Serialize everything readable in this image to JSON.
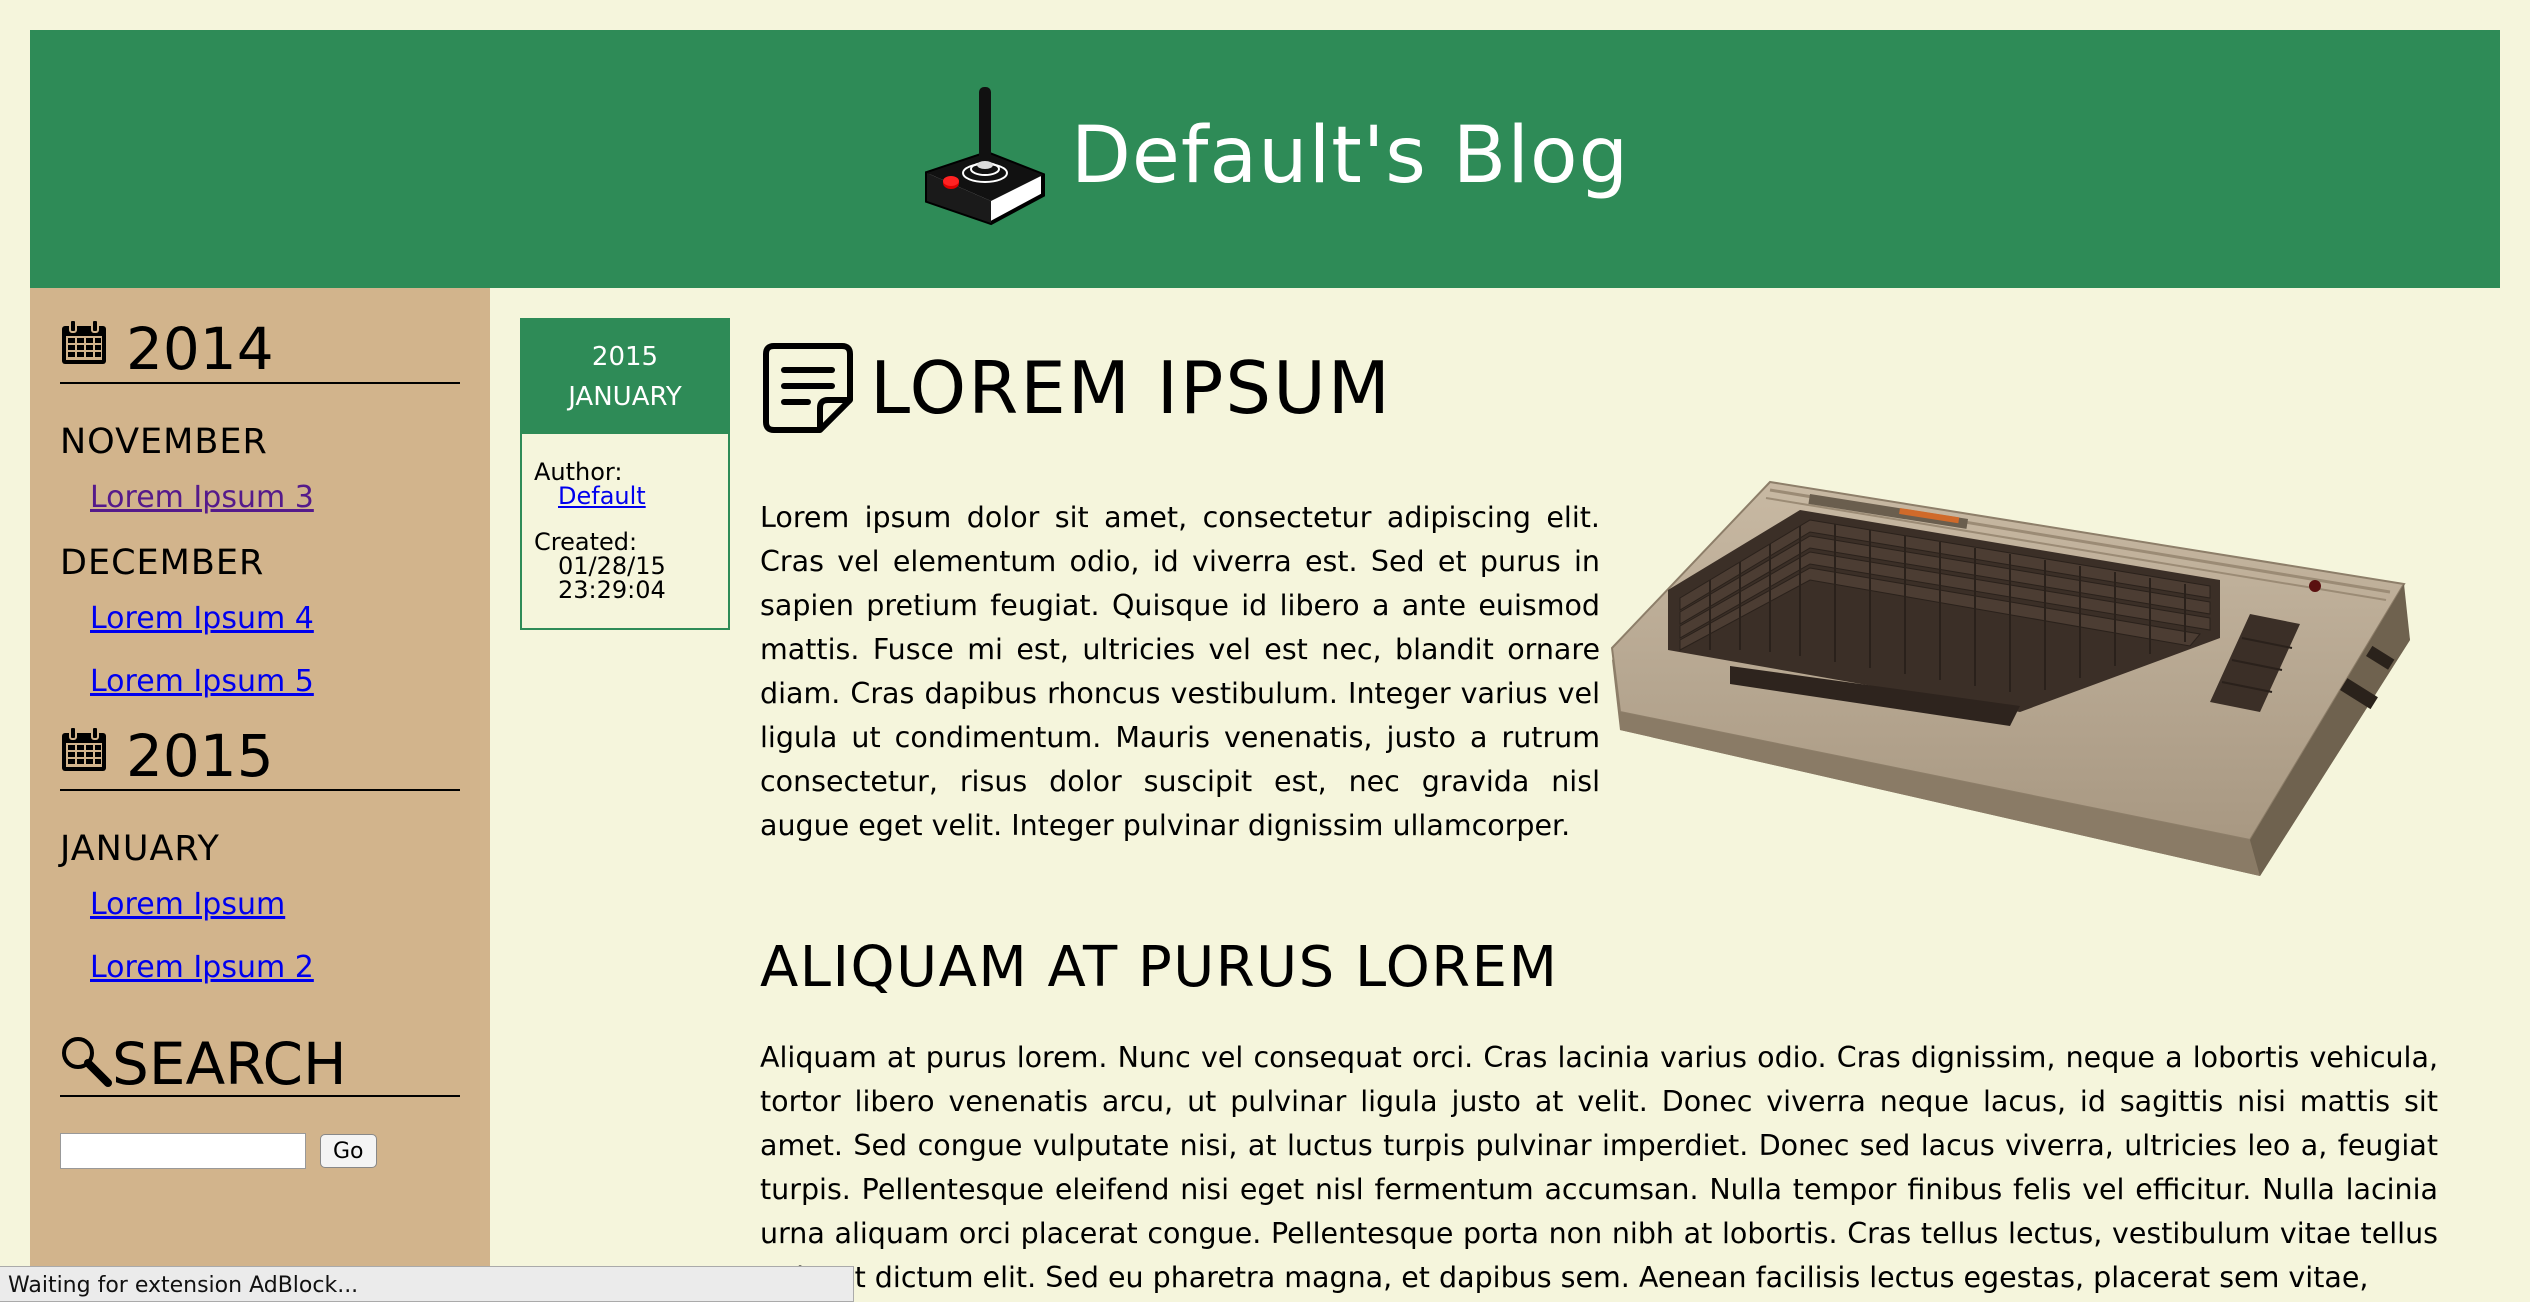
{
  "header": {
    "site_title": "Default's Blog",
    "logo_icon": "joystick-icon"
  },
  "sidebar": {
    "archive": [
      {
        "year": "2014",
        "months": [
          {
            "name": "NOVEMBER",
            "posts": [
              "Lorem Ipsum 3"
            ]
          },
          {
            "name": "DECEMBER",
            "posts": [
              "Lorem Ipsum 4",
              "Lorem Ipsum 5"
            ]
          }
        ]
      },
      {
        "year": "2015",
        "months": [
          {
            "name": "JANUARY",
            "posts": [
              "Lorem Ipsum",
              "Lorem Ipsum 2"
            ]
          }
        ]
      }
    ],
    "search": {
      "heading": "SEARCH",
      "input_value": "",
      "button_label": "Go"
    }
  },
  "post_meta": {
    "year": "2015",
    "month": "JANUARY",
    "author_label": "Author:",
    "author_name": "Default",
    "created_label": "Created:",
    "created_date": "01/28/15",
    "created_time": "23:29:04"
  },
  "article": {
    "title": "LOREM IPSUM",
    "title_icon": "note-icon",
    "intro": "Lorem ipsum dolor sit amet, consectetur adipiscing elit. Cras vel elementum odio, id viverra est. Sed et purus in sapien pretium feugiat. Quisque id libero a ante euismod mattis. Fusce mi est, ultricies vel est nec, blandit ornare diam. Cras dapibus rhoncus vestibulum. Integer varius vel ligula ut condimentum. Mauris venenatis, justo a rutrum consectetur, risus dolor suscipit est, nec gravida nisl augue eget velit. Integer pulvinar dignissim ullamcorper.",
    "image_icon": "home-computer-keyboard-image",
    "section_title": "ALIQUAM AT PURUS LOREM",
    "section_text": "Aliquam at purus lorem. Nunc vel consequat orci. Cras lacinia varius odio. Cras dignissim, neque a lobortis vehicula, tortor libero venenatis arcu, ut pulvinar ligula justo at velit. Donec viverra neque lacus, id sagittis nisi mattis sit amet. Sed congue vulputate nisi, at luctus turpis pulvinar imperdiet. Donec sed lacus viverra, ultricies leo a, feugiat turpis. Pellentesque eleifend nisi eget nisl fermentum accumsan. Nulla tempor finibus felis vel efficitur. Nulla lacinia urna aliquam orci placerat congue. Pellentesque porta non nibh at lobortis. Cras tellus lectus, vestibulum vitae tellus quis, et dictum elit. Sed eu pharetra magna, et dapibus sem. Aenean facilisis lectus egestas, placerat sem vitae,"
  },
  "status_bar": {
    "text": "Waiting for extension AdBlock..."
  },
  "colors": {
    "header_bg": "#2e8b57",
    "sidebar_bg": "#d2b48c",
    "page_bg": "#f5f5dc",
    "link": "#0000ee",
    "visited_link": "#551a8b"
  }
}
